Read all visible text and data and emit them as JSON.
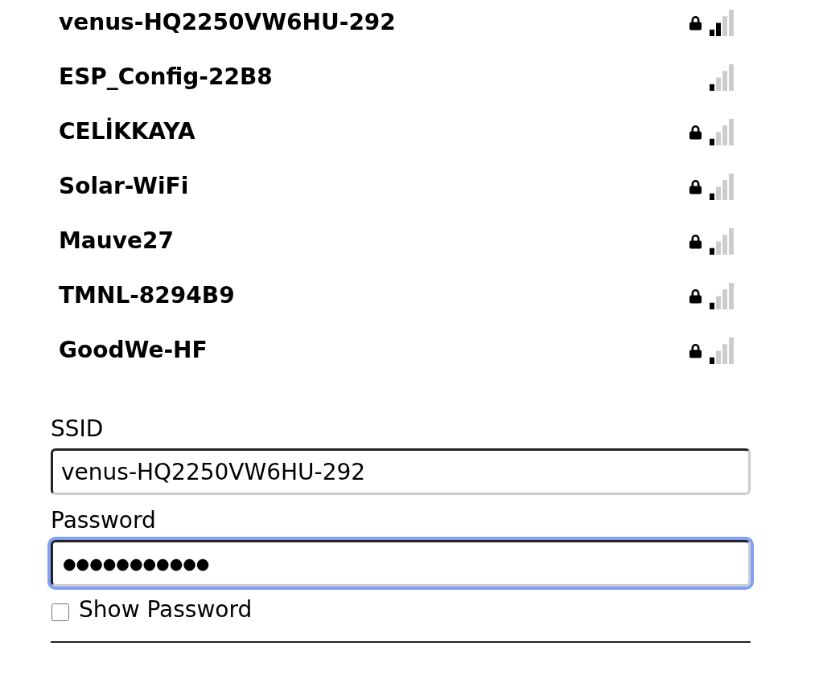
{
  "networks": [
    {
      "ssid": "venus-HQ2250VW6HU-292",
      "locked": true,
      "kind": "fair"
    },
    {
      "ssid": "ESP_Config-22B8",
      "locked": false,
      "kind": "weak"
    },
    {
      "ssid": "CELİKKAYA",
      "locked": true,
      "kind": "weak"
    },
    {
      "ssid": "Solar-WiFi",
      "locked": true,
      "kind": "weak"
    },
    {
      "ssid": "Mauve27",
      "locked": true,
      "kind": "weak"
    },
    {
      "ssid": "TMNL-8294B9",
      "locked": true,
      "kind": "weak"
    },
    {
      "ssid": "GoodWe-HF",
      "locked": true,
      "kind": "weak"
    }
  ],
  "form": {
    "ssid_label": "SSID",
    "ssid_value": "venus-HQ2250VW6HU-292",
    "password_label": "Password",
    "password_value": "●●●●●●●●●●●",
    "password_focused": true,
    "show_password": {
      "label": "Show Password",
      "checked": false
    }
  }
}
